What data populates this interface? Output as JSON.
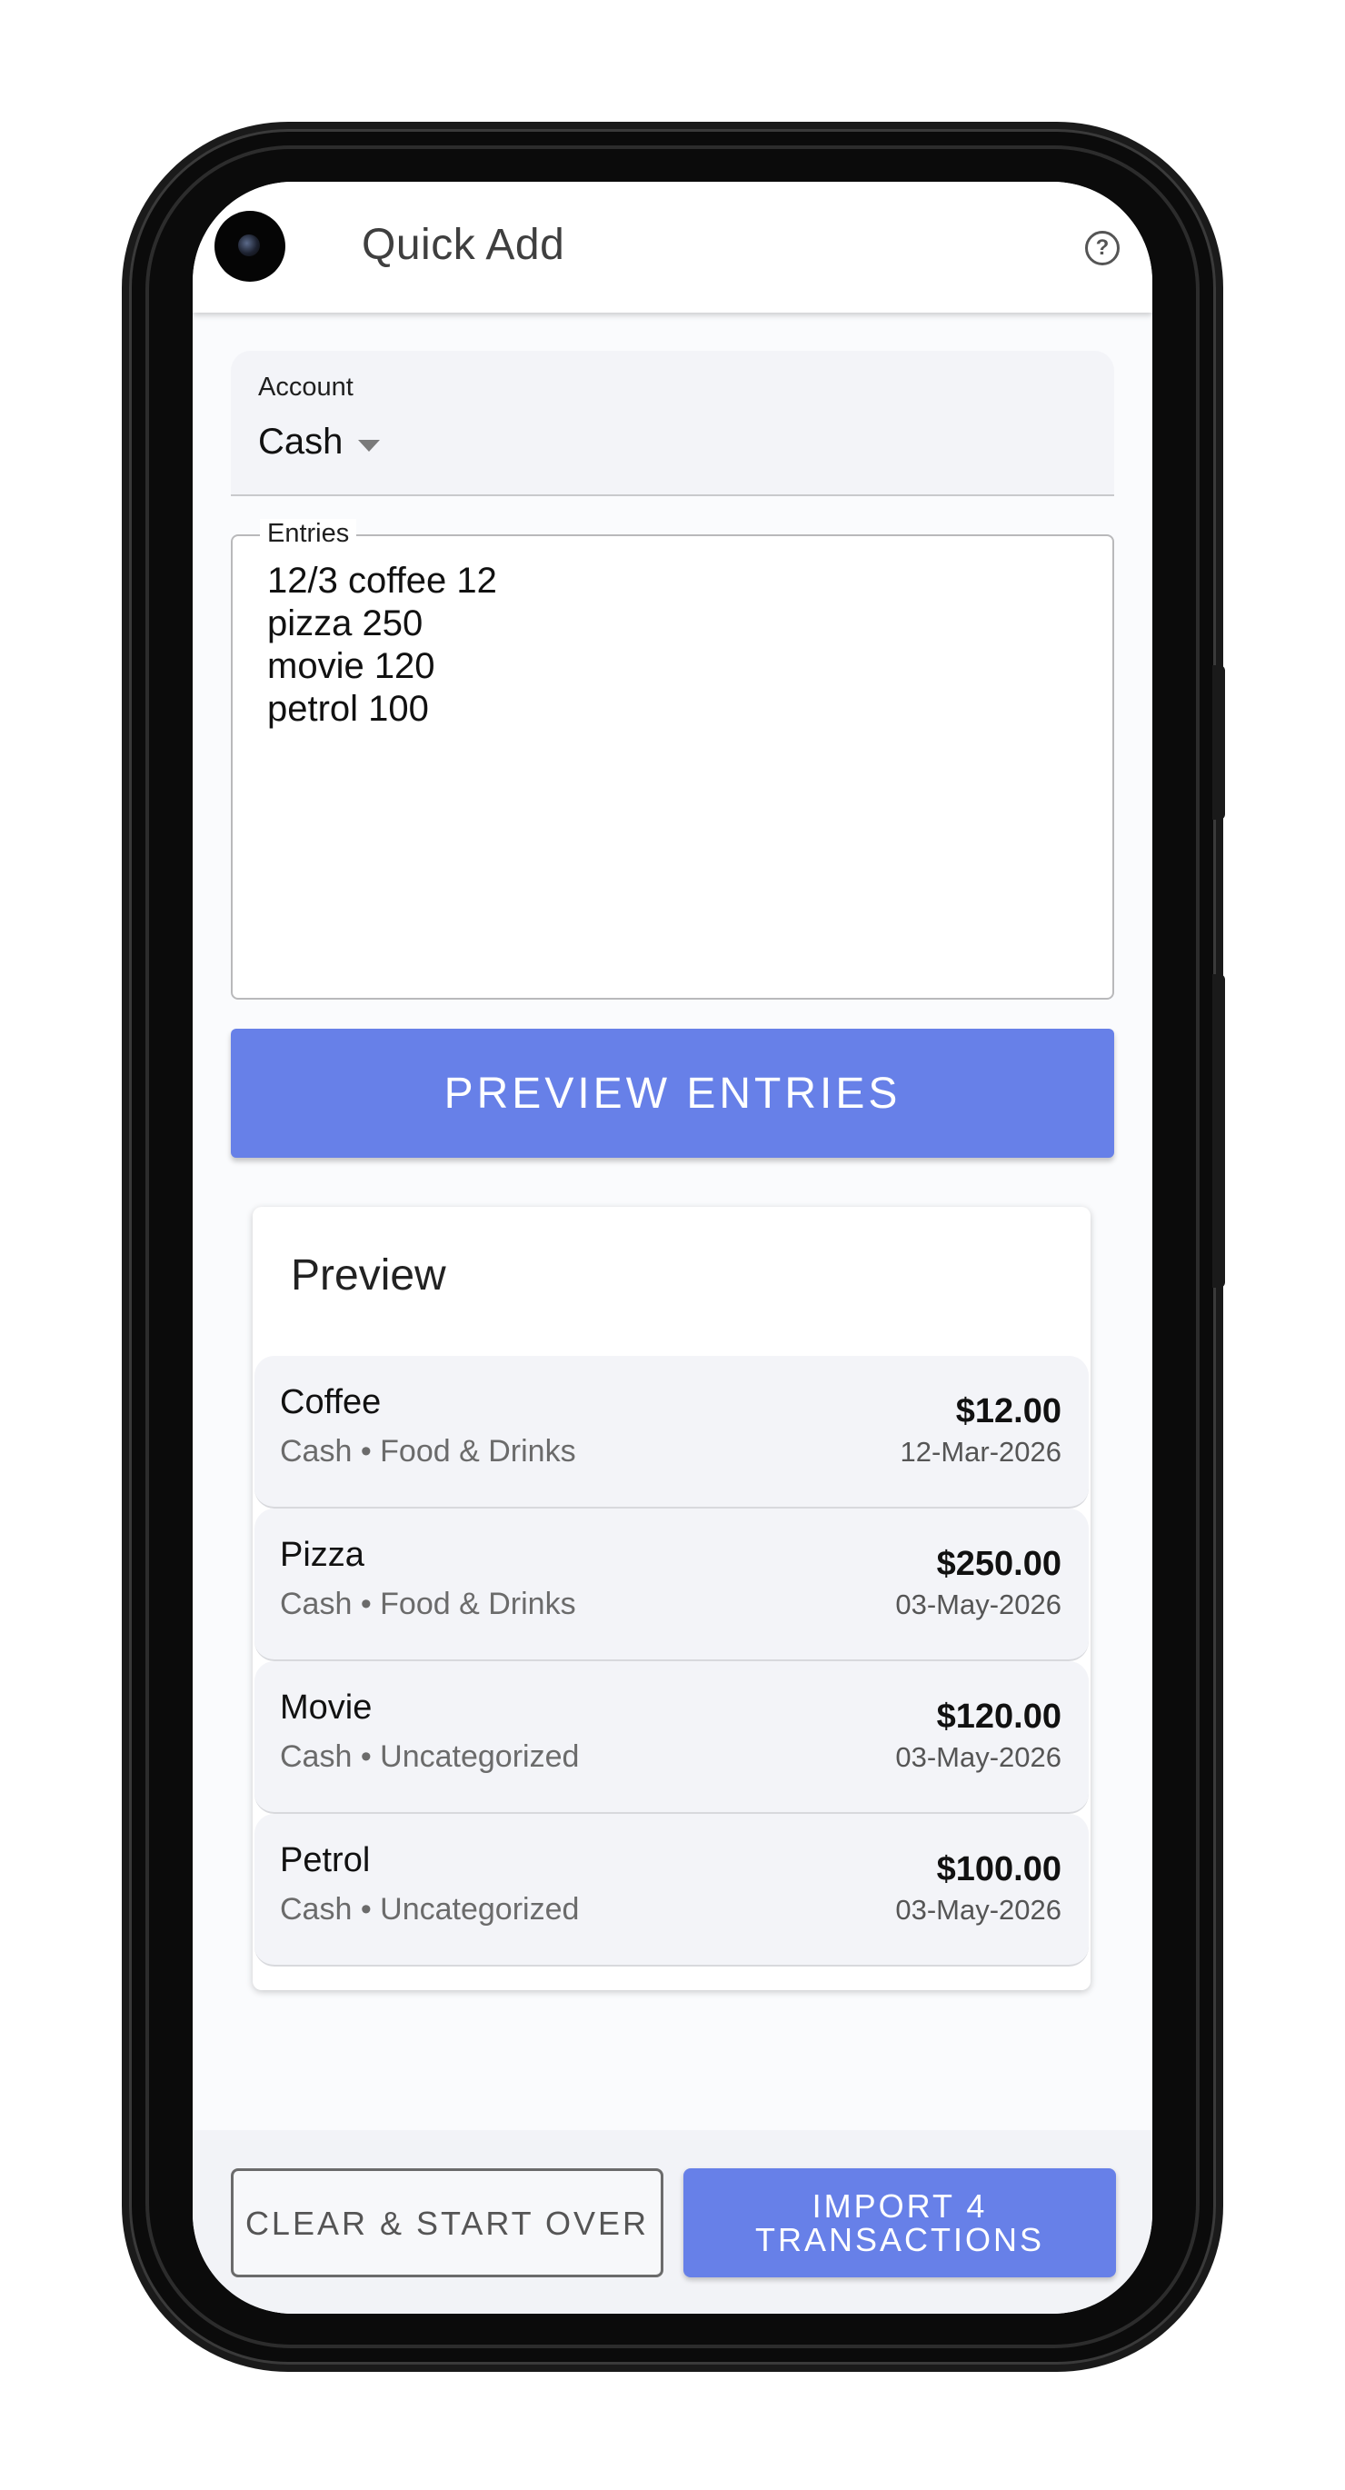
{
  "app_bar": {
    "title": "Quick Add",
    "help_icon": "help-circle-icon",
    "help_glyph": "?"
  },
  "account": {
    "label": "Account",
    "selected": "Cash"
  },
  "entries": {
    "label": "Entries",
    "value": "12/3 coffee 12\npizza 250\nmovie 120\npetrol 100"
  },
  "preview_button": {
    "label": "PREVIEW ENTRIES"
  },
  "preview": {
    "title": "Preview",
    "items": [
      {
        "name": "Coffee",
        "meta": "Cash • Food & Drinks",
        "amount": "$12.00",
        "date": "12-Mar-2026"
      },
      {
        "name": "Pizza",
        "meta": "Cash • Food & Drinks",
        "amount": "$250.00",
        "date": "03-May-2026"
      },
      {
        "name": "Movie",
        "meta": "Cash • Uncategorized",
        "amount": "$120.00",
        "date": "03-May-2026"
      },
      {
        "name": "Petrol",
        "meta": "Cash • Uncategorized",
        "amount": "$100.00",
        "date": "03-May-2026"
      }
    ]
  },
  "bottom_bar": {
    "clear_label": "CLEAR & START OVER",
    "import_label": "IMPORT 4 TRANSACTIONS"
  },
  "colors": {
    "accent": "#6780e8",
    "field_background": "#f3f4f8"
  }
}
